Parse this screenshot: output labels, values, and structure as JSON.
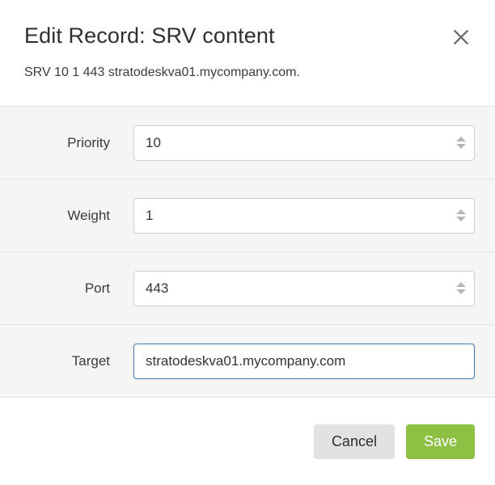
{
  "dialog": {
    "title": "Edit Record: SRV content",
    "subtitle": "SRV 10 1 443 stratodeskva01.mycompany.com.",
    "close_icon": "close-icon"
  },
  "form": {
    "fields": [
      {
        "label": "Priority",
        "value": "10",
        "type": "number",
        "has_stepper": true,
        "focused": false
      },
      {
        "label": "Weight",
        "value": "1",
        "type": "number",
        "has_stepper": true,
        "focused": false
      },
      {
        "label": "Port",
        "value": "443",
        "type": "number",
        "has_stepper": true,
        "focused": false
      },
      {
        "label": "Target",
        "value": "stratodeskva01.mycompany.com",
        "type": "text",
        "has_stepper": false,
        "focused": true
      }
    ]
  },
  "footer": {
    "cancel_label": "Cancel",
    "save_label": "Save"
  },
  "colors": {
    "save_button": "#8ec044",
    "cancel_button": "#e2e2e2",
    "row_background": "#f5f5f5",
    "focus_border": "#4d7ea8",
    "border": "#e2e2e2"
  }
}
